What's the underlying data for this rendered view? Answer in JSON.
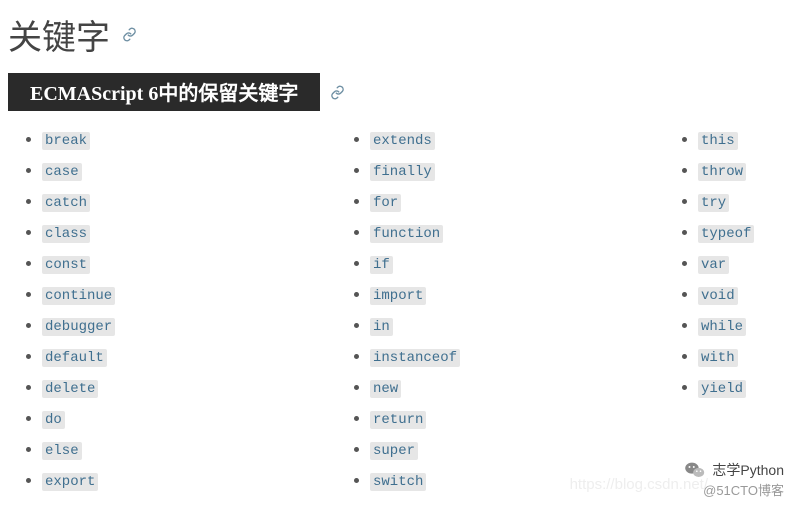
{
  "page_title": "关键字",
  "section_title": "ECMAScript 6中的保留关键字",
  "columns": [
    [
      "break",
      "case",
      "catch",
      "class",
      "const",
      "continue",
      "debugger",
      "default",
      "delete",
      "do",
      "else",
      "export"
    ],
    [
      "extends",
      "finally",
      "for",
      "function",
      "if",
      "import",
      "in",
      "instanceof",
      "new",
      "return",
      "super",
      "switch"
    ],
    [
      "this",
      "throw",
      "try",
      "typeof",
      "var",
      "void",
      "while",
      "with",
      "yield"
    ]
  ],
  "brand_text": "志学Python",
  "sub_watermark": "@51CTO博客",
  "bg_watermark": "https://blog.csdn.net/"
}
